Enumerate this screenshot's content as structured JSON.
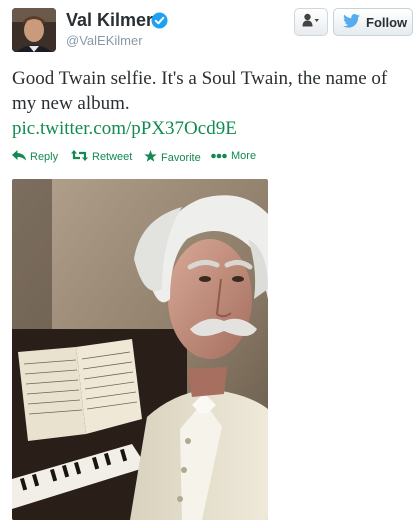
{
  "user": {
    "name": "Val Kilmer",
    "handle": "@ValEKilmer",
    "verified": true
  },
  "buttons": {
    "follow_label": "Follow",
    "user_actions_icon": "user-dropdown-icon"
  },
  "tweet": {
    "text": "Good Twain selfie. It's a Soul Twain, the name of my new album.",
    "link": "pic.twitter.com/pPX37Ocd9E"
  },
  "actions": {
    "reply": "Reply",
    "retweet": "Retweet",
    "favorite": "Favorite",
    "more": "More"
  },
  "colors": {
    "link": "#138a52",
    "verified": "#1da1f2",
    "twitter_bird": "#55acee",
    "text": "#292f33",
    "handle": "#8899a6"
  }
}
